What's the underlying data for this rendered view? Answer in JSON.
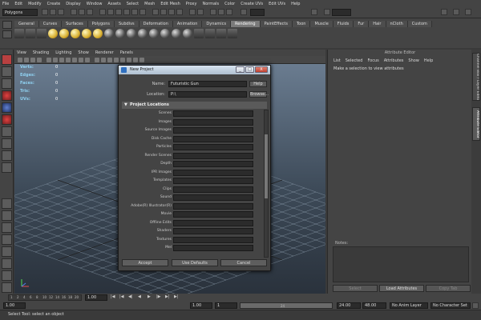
{
  "menubar": [
    "File",
    "Edit",
    "Modify",
    "Create",
    "Display",
    "Window",
    "Assets",
    "Select",
    "Mesh",
    "Edit Mesh",
    "Proxy",
    "Normals",
    "Color",
    "Create UVs",
    "Edit UVs",
    "Help"
  ],
  "statusline": {
    "mode": "Polygons"
  },
  "shelf": {
    "tabs": [
      "General",
      "Curves",
      "Surfaces",
      "Polygons",
      "Subdivs",
      "Deformation",
      "Animation",
      "Dynamics",
      "Rendering",
      "PaintEffects",
      "Toon",
      "Muscle",
      "Fluids",
      "Fur",
      "Hair",
      "nCloth",
      "Custom"
    ],
    "active_tab": "Rendering"
  },
  "viewport": {
    "menu": [
      "View",
      "Shading",
      "Lighting",
      "Show",
      "Renderer",
      "Panels"
    ],
    "hud_labels": [
      "Verts:",
      "Edges:",
      "Faces:",
      "Tris:",
      "UVs:"
    ],
    "hud_value": "0",
    "grid_color": "#8a9aaa"
  },
  "dialog": {
    "title": "New Project",
    "window_buttons": {
      "minimize": "_",
      "maximize": "□",
      "close": "X"
    },
    "name_label": "Name:",
    "name_value": "Futuristic Gun",
    "help_button": "Help",
    "location_label": "Location:",
    "location_value": "P:\\",
    "browse_button": "Browse...",
    "section_arrow": "▼",
    "section_title": "Project Locations",
    "locations": [
      "Scenes",
      "Images",
      "Source Images",
      "Disk Cache",
      "Particles",
      "Render Scenes",
      "Depth",
      "IPR Images",
      "Templates",
      "Clips",
      "Sound",
      "Adobe(R) Illustrator(R)",
      "Movie",
      "Offline Edits",
      "Shaders",
      "Textures",
      "Mel"
    ],
    "buttons": {
      "accept": "Accept",
      "defaults": "Use Defaults",
      "cancel": "Cancel"
    }
  },
  "attribute_editor": {
    "title": "Attribute Editor",
    "menu": [
      "List",
      "Selected",
      "Focus",
      "Attributes",
      "Show",
      "Help"
    ],
    "hint": "Make a selection to view attributes",
    "notes_label": "Notes:",
    "buttons": [
      "Select",
      "Load Attributes",
      "Copy Tab"
    ]
  },
  "side_tabs": [
    "Channel Box / Layer Editor",
    "Attribute Editor"
  ],
  "timeslider": {
    "ticks": [
      "1",
      "2",
      "4",
      "6",
      "8",
      "10",
      "12",
      "14",
      "16",
      "18",
      "20"
    ]
  },
  "rangeslider": {
    "start_time": "1.00",
    "current_time": "1.00",
    "range_start": "1.00",
    "range_start_frame": "1",
    "range_end_frame": "24",
    "range_end": "24.00",
    "end_time": "48.00",
    "anim_layer": "No Anim Layer",
    "character_set": "No Character Set"
  },
  "helpline": "Select Tool: select an object"
}
